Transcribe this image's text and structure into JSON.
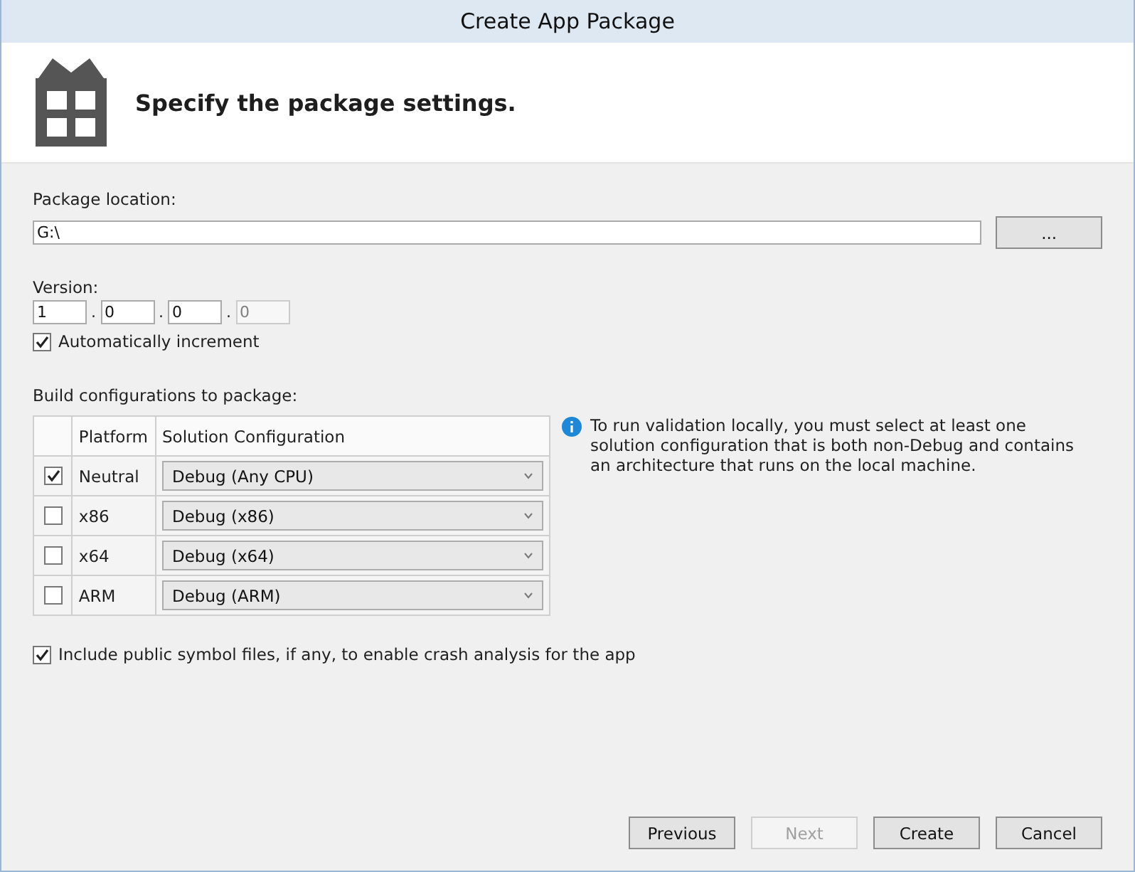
{
  "window": {
    "title": "Create App Package"
  },
  "header": {
    "title": "Specify the package settings."
  },
  "package_location": {
    "label": "Package location:",
    "value": "G:\\",
    "browse_button": "..."
  },
  "version": {
    "label": "Version:",
    "parts": [
      {
        "value": "1",
        "disabled": false
      },
      {
        "value": "0",
        "disabled": false
      },
      {
        "value": "0",
        "disabled": false
      },
      {
        "value": "0",
        "disabled": true
      }
    ],
    "separator": ".",
    "auto_increment": {
      "label": "Automatically increment",
      "checked": true
    }
  },
  "build_configurations": {
    "label": "Build configurations to package:",
    "columns": [
      "Platform",
      "Solution Configuration"
    ],
    "rows": [
      {
        "checked": true,
        "platform": "Neutral",
        "configuration": "Debug (Any CPU)"
      },
      {
        "checked": false,
        "platform": "x86",
        "configuration": "Debug (x86)"
      },
      {
        "checked": false,
        "platform": "x64",
        "configuration": "Debug (x64)"
      },
      {
        "checked": false,
        "platform": "ARM",
        "configuration": "Debug (ARM)"
      }
    ]
  },
  "info_message": "To run validation locally, you must select at least one solution configuration that is both non-Debug and contains an architecture that runs on the local machine.",
  "include_symbols": {
    "label": "Include public symbol files, if any, to enable crash analysis for the app",
    "checked": true
  },
  "buttons": [
    {
      "label": "Previous",
      "disabled": false
    },
    {
      "label": "Next",
      "disabled": true
    },
    {
      "label": "Create",
      "disabled": false
    },
    {
      "label": "Cancel",
      "disabled": false
    }
  ]
}
